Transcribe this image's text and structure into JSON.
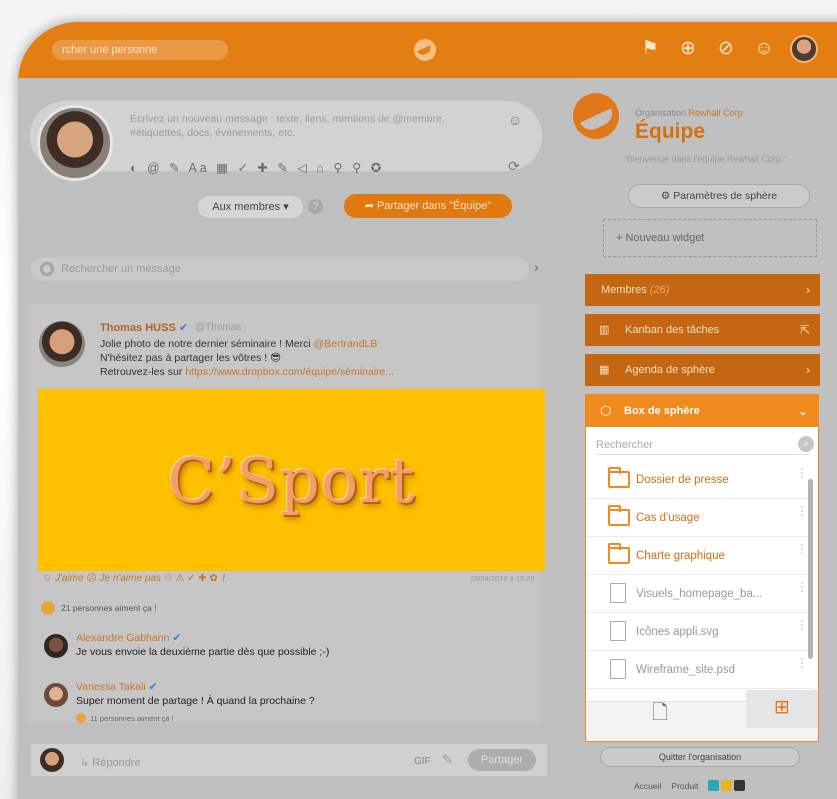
{
  "topbar": {
    "search_placeholder": "rcher une personne",
    "icons": [
      "flag-icon",
      "add-sphere-icon",
      "add-event-icon",
      "add-contact-icon",
      "user-avatar"
    ]
  },
  "composer": {
    "placeholder_line1": "Écrivez un nouveau message : texte, liens, mentions de @membre,",
    "placeholder_line2": "#étiquettes, docs, événements, etc.",
    "tools": "◐ @ ✎ Aa ▦ ✓ ✚ ✎ ◁ ⌂ ⚲ ⚲ ✪",
    "audience": "Aux membres ▾",
    "share_label": "➦  Partager dans \"Équipe\""
  },
  "message_search": {
    "placeholder": "Rechercher un message"
  },
  "post": {
    "author": "Thomas HUSS",
    "handle": "@Thomas",
    "line1_a": "Jolie photo de notre dernier séminaire ! Merci ",
    "line1_mention": "@BertrandLB",
    "line2": "N'hésitez pas à partager les vôtres ! 😎",
    "line3_a": "Retrouvez-les sur ",
    "line3_link": "https://www.dropbox.com/équipe/séminaire...",
    "image_text": "C’Sport",
    "like_label": "☺ J'aime  ☹ Je n'aime pas  ♲ ⚠ ✓ ✚ ✿ ⌇",
    "date": "23/04/2019 à 15:26",
    "likes_count": "21 personnes aiment ça !"
  },
  "comments": [
    {
      "name": "Alexandre Gabhann",
      "text": "Je vous envoie la deuxième partie dès que possible ;-)"
    },
    {
      "name": "Vanessa Takali",
      "text": "Super moment de partage ! À quand la prochaine ?",
      "likes": "11 personnes aiment ça !"
    }
  ],
  "reply": {
    "placeholder": "↳ Répondre",
    "gif": "GIF",
    "share": "Partager"
  },
  "organisation": {
    "caption": "Organisation",
    "company": "Rewhall Corp.",
    "name": "Équipe",
    "welcome": "\"Bienvenue dans l'équipe Rewhall Corp.\"",
    "settings": "⚙ Paramètres de sphère",
    "new_widget": "+  Nouveau widget"
  },
  "panels": {
    "members_label": "Membres",
    "members_count": "(26)",
    "kanban": "Kanban des tâches",
    "agenda": "Agenda de sphère",
    "box": "Box de sphère"
  },
  "box": {
    "search_placeholder": "Rechercher",
    "files": [
      {
        "name": "Dossier de presse",
        "type": "folder"
      },
      {
        "name": "Cas d'usage",
        "type": "folder"
      },
      {
        "name": "Charte graphique",
        "type": "folder"
      },
      {
        "name": "Visuels_homepage_ba...",
        "type": "file"
      },
      {
        "name": "Icônes appli.svg",
        "type": "file"
      },
      {
        "name": "Wireframe_site.psd",
        "type": "file"
      }
    ]
  },
  "footer": {
    "quit": "Quitter l'organisation",
    "links": [
      "Accueil",
      "Produit"
    ]
  },
  "colors": {
    "brand": "#e27e12",
    "panel": "#c56612",
    "box_header": "#f08a1f",
    "image_bg": "#ffc000"
  }
}
